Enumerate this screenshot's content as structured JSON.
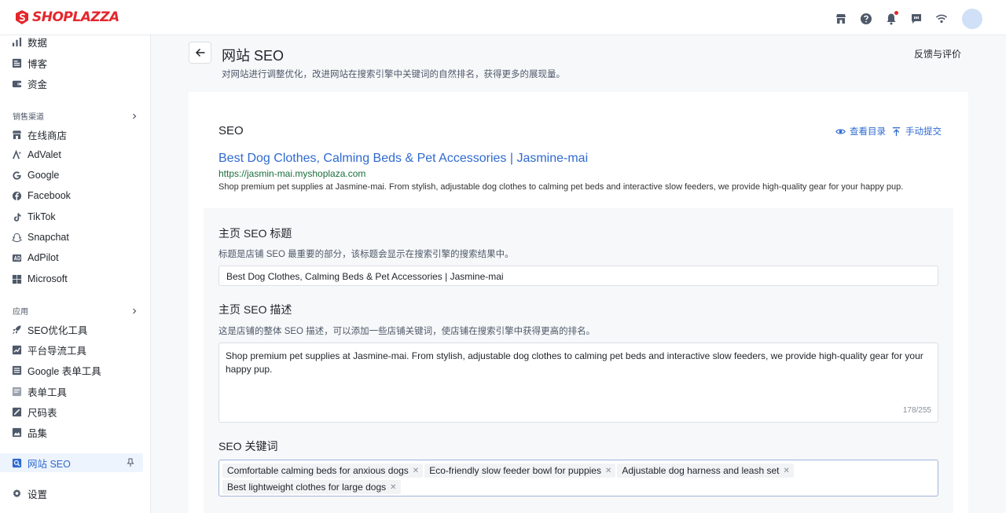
{
  "brand": {
    "name": "SHOPLAZZA"
  },
  "sidebar": {
    "items_top": [
      {
        "label": "数据",
        "icon": "bar-chart-icon"
      },
      {
        "label": "博客",
        "icon": "blog-icon"
      },
      {
        "label": "资金",
        "icon": "wallet-icon"
      }
    ],
    "section_sales": "销售渠道",
    "sales_items": [
      {
        "label": "在线商店",
        "icon": "store-icon"
      },
      {
        "label": "AdValet",
        "icon": "advalet-icon"
      },
      {
        "label": "Google",
        "icon": "google-icon"
      },
      {
        "label": "Facebook",
        "icon": "facebook-icon"
      },
      {
        "label": "TikTok",
        "icon": "tiktok-icon"
      },
      {
        "label": "Snapchat",
        "icon": "snapchat-icon"
      },
      {
        "label": "AdPilot",
        "icon": "adpilot-icon"
      },
      {
        "label": "Microsoft",
        "icon": "microsoft-icon"
      }
    ],
    "section_apps": "应用",
    "app_items": [
      {
        "label": "SEO优化工具",
        "icon": "rocket-icon"
      },
      {
        "label": "平台导流工具",
        "icon": "trend-icon"
      },
      {
        "label": "Google 表单工具",
        "icon": "form-icon"
      },
      {
        "label": "表单工具",
        "icon": "form2-icon"
      },
      {
        "label": "尺码表",
        "icon": "ruler-icon"
      },
      {
        "label": "品集",
        "icon": "image-icon"
      }
    ],
    "active_item": {
      "label": "网站 SEO",
      "icon": "seo-icon"
    },
    "settings": {
      "label": "设置",
      "icon": "gear-icon"
    }
  },
  "header": {
    "title": "网站 SEO",
    "subtitle": "对网站进行调整优化，改进网站在搜索引擎中关键词的自然排名，获得更多的展现量。",
    "feedback": "反馈与评价"
  },
  "seo": {
    "heading": "SEO",
    "view_directory": "查看目录",
    "manual_submit": "手动提交",
    "preview": {
      "title": "Best Dog Clothes, Calming Beds & Pet Accessories | Jasmine-mai",
      "url": "https://jasmin-mai.myshoplaza.com",
      "description": "Shop premium pet supplies at Jasmine-mai. From stylish, adjustable dog clothes to calming pet beds and interactive slow feeders, we provide high-quality gear for your happy pup."
    },
    "title_field": {
      "label": "主页 SEO 标题",
      "help": "标题是店铺 SEO 最重要的部分，该标题会显示在搜索引擎的搜索结果中。",
      "value": "Best Dog Clothes, Calming Beds & Pet Accessories | Jasmine-mai"
    },
    "desc_field": {
      "label": "主页 SEO 描述",
      "help": "这是店铺的整体 SEO 描述，可以添加一些店铺关键词，使店铺在搜索引擎中获得更高的排名。",
      "value": "Shop premium pet supplies at Jasmine-mai. From stylish, adjustable dog clothes to calming pet beds and interactive slow feeders, we provide high-quality gear for your happy pup.",
      "counter": "178/255"
    },
    "keywords_field": {
      "label": "SEO 关键词",
      "tags": [
        "Comfortable calming beds for anxious dogs",
        "Eco-friendly slow feeder bowl for puppies",
        "Adjustable dog harness and leash set",
        "Best lightweight clothes for large dogs"
      ]
    }
  },
  "colors": {
    "accent": "#2f6ad0",
    "brand": "#e4262c"
  }
}
